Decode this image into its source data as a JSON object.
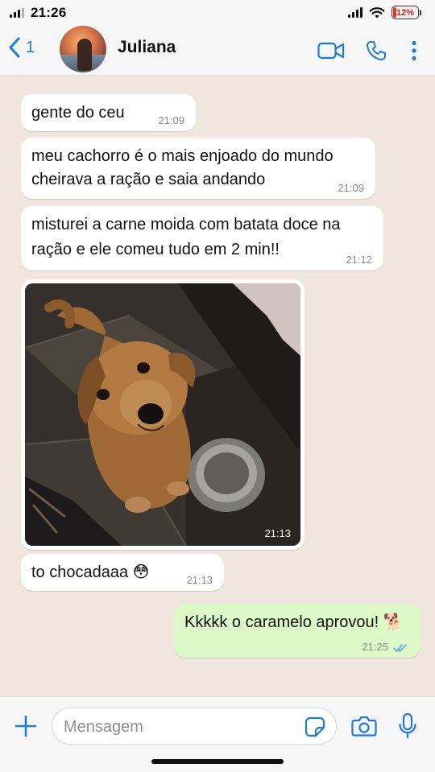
{
  "status_bar": {
    "time": "21:26",
    "battery": "12%"
  },
  "header": {
    "back_count": "1",
    "contact_name": "Juliana"
  },
  "messages": [
    {
      "text": "gente do ceu",
      "time": "21:09"
    },
    {
      "text": "meu cachorro é o mais enjoado do mundo",
      "text2": "cheirava a ração e saia andando",
      "time": "21:09"
    },
    {
      "text": "misturei a carne moida com batata doce na",
      "text2": "ração e ele comeu tudo em 2 min!!",
      "time": "21:12"
    },
    {
      "type": "image",
      "time": "21:13"
    },
    {
      "text": "to chocadaaa 😳",
      "time": "21:13"
    },
    {
      "text": "Kkkkk o caramelo aprovou! 🐕",
      "time": "21:25",
      "outgoing": true,
      "status": "read"
    }
  ],
  "input": {
    "placeholder": "Mensagem"
  },
  "colors": {
    "accent": "#1f7ae0",
    "outgoing_bubble": "#dcf8c6",
    "incoming_bubble": "#ffffff",
    "chat_background": "#efe7dd"
  }
}
